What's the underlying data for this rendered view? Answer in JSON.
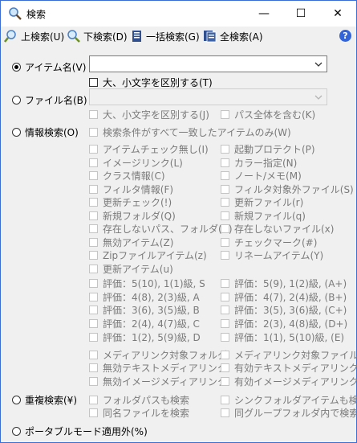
{
  "window": {
    "title": "検索",
    "minimize": "—",
    "maximize": "☐",
    "close": "✕"
  },
  "toolbar": {
    "search_up": "上検索(U)",
    "search_down": "下検索(D)",
    "search_batch": "一括検索(G)",
    "search_all": "全検索(A)",
    "help": "?"
  },
  "item_name": {
    "label": "アイテム名(V)",
    "value": "",
    "case": "大、小文字を区別する(T)"
  },
  "file_name": {
    "label": "ファイル名(B)",
    "value": "",
    "case": "大、小文字を区別する(J)",
    "full_path": "パス全体を含む(K)"
  },
  "info": {
    "label": "情報検索(O)",
    "all_match": "検索条件がすべて一致したアイテムのみ(W)",
    "left": [
      "アイテムチェック無し(I)",
      "イメージリンク(L)",
      "クラス情報(C)",
      "フィルタ情報(F)",
      "更新チェック(!)",
      "新規フォルダ(Q)",
      "存在しないパス、フォルダ(X)",
      "無効アイテム(Z)",
      "Zipファイルアイテム(z)",
      "更新アイテム(u)"
    ],
    "right": [
      "起動プロテクト(P)",
      "カラー指定(N)",
      "ノート/メモ(M)",
      "フィルタ対象外ファイル(S)",
      "更新ファイル(r)",
      "新規ファイル(q)",
      "存在しないファイル(x)",
      "チェックマーク(#)",
      "リネームアイテム(Y)"
    ],
    "rating_left": [
      "評価：5(10), 1(1)級, S",
      "評価：4(8), 2(3)級, A",
      "評価：3(6), 3(5)級, B",
      "評価：2(4), 4(7)級, C",
      "評価：1(2), 5(9)級, D"
    ],
    "rating_right": [
      "評価：5(9), 1(2)級, (A+)",
      "評価：4(7), 2(4)級, (B+)",
      "評価：3(5), 3(6)級, (C+)",
      "評価：2(3), 4(8)級, (D+)",
      "評価：1(1), 5(10)級, (E)"
    ],
    "media_left": [
      "メディアリンク対象フォルダ",
      "無効テキストメディアリンク",
      "無効イメージメディアリンク"
    ],
    "media_right": [
      "メディアリンク対象ファイル",
      "有効テキストメディアリンク",
      "有効イメージメディアリンク"
    ]
  },
  "duplicate": {
    "label": "重複検索(¥)",
    "opts_left": [
      "フォルダパスも検索",
      "同名ファイルを検索"
    ],
    "opts_right": [
      "シンクフォルダアイテムも検索",
      "同グループフォルダ内で検索"
    ]
  },
  "portable": {
    "label": "ポータブルモード適用外(%)"
  }
}
